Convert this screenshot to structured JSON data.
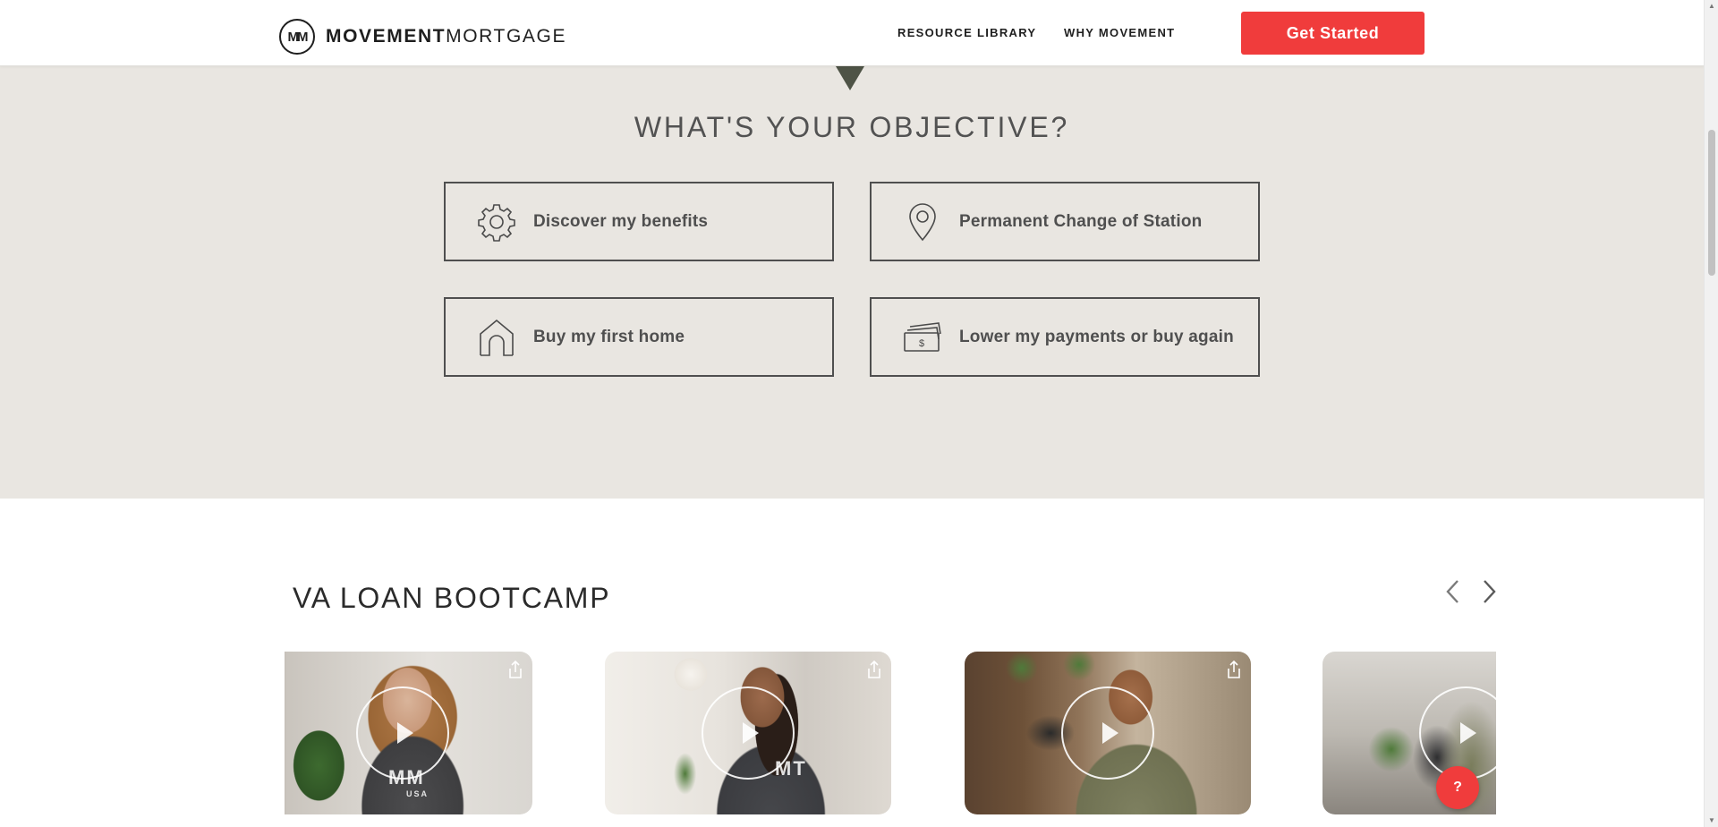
{
  "header": {
    "logo_mark": "MM",
    "logo_bold": "MOVEMENT",
    "logo_light": "MORTGAGE",
    "nav": [
      "RESOURCE LIBRARY",
      "WHY MOVEMENT"
    ],
    "cta_label": "Get Started"
  },
  "objective": {
    "title": "WHAT'S YOUR OBJECTIVE?",
    "options": [
      {
        "label": "Discover my benefits",
        "icon": "gear-icon"
      },
      {
        "label": "Permanent Change of Station",
        "icon": "map-pin-icon"
      },
      {
        "label": "Buy my first home",
        "icon": "house-icon"
      },
      {
        "label": "Lower my payments or buy again",
        "icon": "money-icon"
      }
    ]
  },
  "bootcamp": {
    "title": "VA LOAN BOOTCAMP",
    "videos": [
      {
        "shirt": "MM",
        "shirt_sub": "USA"
      },
      {
        "shirt": "MT",
        "shirt_sub": ""
      },
      {
        "shirt": "",
        "shirt_sub": ""
      },
      {
        "shirt": "",
        "shirt_sub": ""
      }
    ]
  },
  "help_label": "?",
  "colors": {
    "accent": "#f03c3c",
    "section_bg": "#e9e6e1",
    "pointer": "#4e5346",
    "text_dark": "#4f4f4f"
  }
}
